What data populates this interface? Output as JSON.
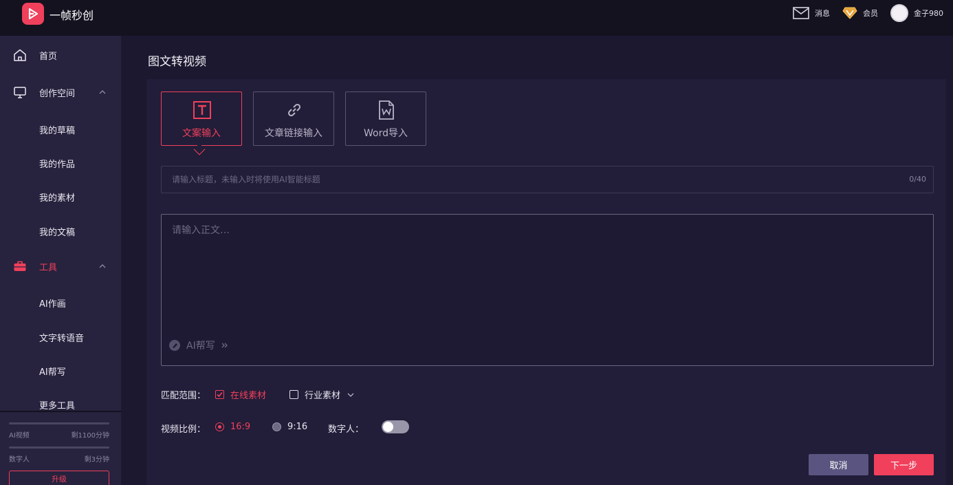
{
  "app": {
    "name": "一帧秒创"
  },
  "topbar": {
    "messages_label": "消息",
    "vip_label": "会员",
    "coins_label": "金子980"
  },
  "sidebar": {
    "home": "首页",
    "creative_space": "创作空间",
    "creative_items": [
      "我的草稿",
      "我的作品",
      "我的素材",
      "我的文稿"
    ],
    "tools": "工具",
    "tool_items": [
      "AI作画",
      "文字转语音",
      "AI帮写",
      "更多工具"
    ],
    "quota": [
      {
        "label": "AI视频",
        "value": "剩1100分钟"
      },
      {
        "label": "数字人",
        "value": "剩3分钟"
      }
    ],
    "upgrade_label": "升级"
  },
  "main": {
    "page_title": "图文转视频",
    "modes": [
      {
        "label": "文案输入",
        "icon": "text-t-icon",
        "active": true
      },
      {
        "label": "文章链接输入",
        "icon": "link-icon",
        "active": false
      },
      {
        "label": "Word导入",
        "icon": "word-file-icon",
        "active": false
      }
    ],
    "title_input": {
      "placeholder": "请输入标题，未输入时将使用AI智能标题",
      "value": "",
      "counter": "0/40"
    },
    "body_input": {
      "placeholder": "请输入正文…",
      "value": ""
    },
    "ai_help_label": "AI帮写",
    "match_range": {
      "label": "匹配范围：",
      "online": {
        "label": "在线素材",
        "checked": true
      },
      "industry": {
        "label": "行业素材",
        "checked": false
      }
    },
    "ratio": {
      "label": "视频比例：",
      "options": [
        {
          "label": "16:9",
          "checked": true
        },
        {
          "label": "9:16",
          "checked": false
        }
      ]
    },
    "digital_human": {
      "label": "数字人：",
      "enabled": false
    },
    "buttons": {
      "cancel": "取消",
      "next": "下一步"
    }
  },
  "colors": {
    "accent": "#f0405c",
    "background": "#1c1830",
    "sidebar": "#27223d",
    "topbar": "#14121f"
  }
}
